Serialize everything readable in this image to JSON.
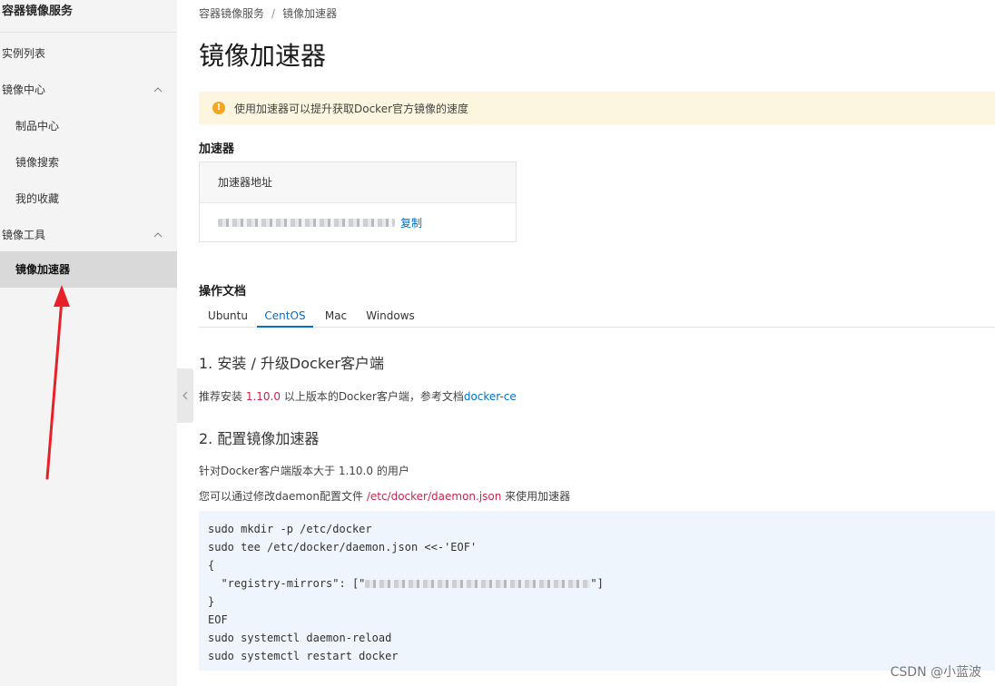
{
  "sidebar": {
    "title": "容器镜像服务",
    "items": [
      {
        "label": "实例列表"
      },
      {
        "label": "镜像中心"
      },
      {
        "label": "制品中心"
      },
      {
        "label": "镜像搜索"
      },
      {
        "label": "我的收藏"
      },
      {
        "label": "镜像工具"
      },
      {
        "label": "镜像加速器"
      }
    ]
  },
  "breadcrumb": {
    "root": "容器镜像服务",
    "sep": "/",
    "current": "镜像加速器"
  },
  "page_title": "镜像加速器",
  "alert": {
    "text": "使用加速器可以提升获取Docker官方镜像的速度"
  },
  "accelerator": {
    "heading": "加速器",
    "box_header": "加速器地址",
    "copy_label": "复制"
  },
  "docs": {
    "heading": "操作文档",
    "tabs": [
      "Ubuntu",
      "CentOS",
      "Mac",
      "Windows"
    ],
    "active_tab": "CentOS",
    "step1_title": "1. 安装 / 升级Docker客户端",
    "step1_text_before": "推荐安装 ",
    "step1_version": "1.10.0",
    "step1_text_after": " 以上版本的Docker客户端，参考文档",
    "step1_link": "docker-ce",
    "step2_title": "2. 配置镜像加速器",
    "step2_line1": "针对Docker客户端版本大于 1.10.0 的用户",
    "step2_line2_before": "您可以通过修改daemon配置文件 ",
    "step2_path": "/etc/docker/daemon.json",
    "step2_line2_after": " 来使用加速器"
  },
  "code": {
    "l1": "sudo mkdir -p /etc/docker",
    "l2": "sudo tee /etc/docker/daemon.json <<-'EOF'",
    "l3": "{",
    "l4_before": "  \"registry-mirrors\": [\"",
    "l4_after": "\"]",
    "l5": "}",
    "l6": "EOF",
    "l7": "sudo systemctl daemon-reload",
    "l8": "sudo systemctl restart docker"
  },
  "watermark": "CSDN @小蓝波",
  "colors": {
    "accent": "#0070cc",
    "alert_bg": "#fdf6de",
    "code_bg": "#eef5fc",
    "arrow": "#e8202a"
  }
}
